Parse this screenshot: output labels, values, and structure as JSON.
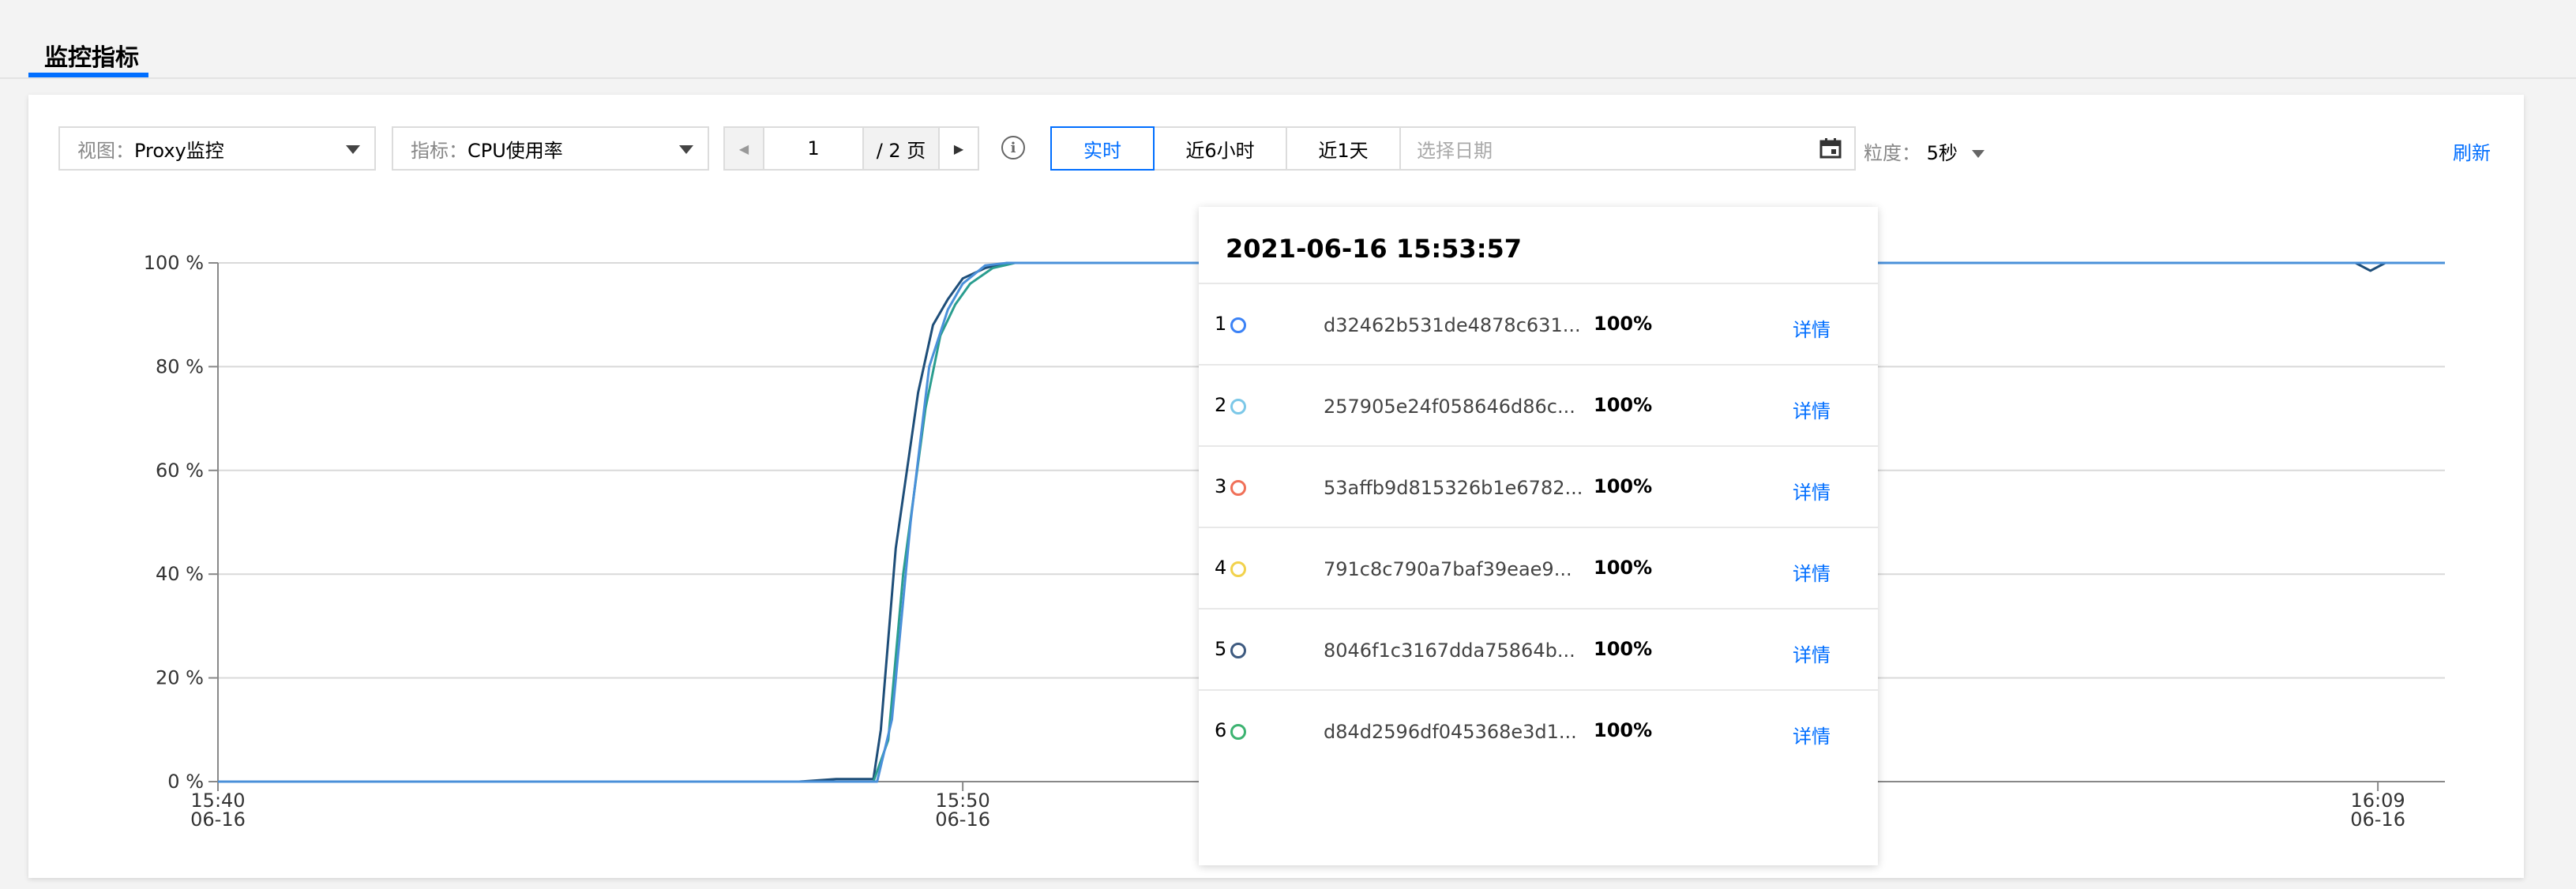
{
  "page": {
    "tab_title": "监控指标"
  },
  "toolbar": {
    "view_label": "视图：",
    "view_value": "Proxy监控",
    "metric_label": "指标：",
    "metric_value": "CPU使用率",
    "page_current": "1",
    "page_total": "/ 2 页",
    "range_buttons": [
      "实时",
      "近6小时",
      "近1天"
    ],
    "date_placeholder": "选择日期",
    "granularity_label": "粒度：",
    "granularity_value": "5秒",
    "refresh": "刷新"
  },
  "chart_data": {
    "type": "line",
    "y_ticks": [
      "100 %",
      "80 %",
      "60 %",
      "40 %",
      "20 %",
      "0 %"
    ],
    "ylim": [
      0,
      100
    ],
    "x_ticks": [
      {
        "time": "15:40",
        "date": "06-16"
      },
      {
        "time": "15:50",
        "date": "06-16"
      },
      {
        "time": "16:09",
        "date": "06-16"
      }
    ],
    "x_tick_minutes": [
      0,
      10,
      29
    ],
    "xlim_minutes": [
      0,
      29.9
    ],
    "grid": true,
    "series": [
      {
        "color": "#1e4e79",
        "points": [
          [
            0,
            0
          ],
          [
            7.8,
            0
          ],
          [
            8.3,
            0.5
          ],
          [
            8.8,
            0.5
          ],
          [
            8.9,
            10
          ],
          [
            9.1,
            45
          ],
          [
            9.4,
            75
          ],
          [
            9.6,
            88
          ],
          [
            9.8,
            93
          ],
          [
            10.0,
            97
          ],
          [
            10.3,
            99
          ],
          [
            10.6,
            100
          ],
          [
            14.5,
            100
          ],
          [
            14.7,
            99.5
          ],
          [
            14.9,
            100
          ],
          [
            28.7,
            100
          ],
          [
            28.9,
            98.5
          ],
          [
            29.1,
            100
          ],
          [
            29.9,
            100
          ]
        ]
      },
      {
        "color": "#2a9d8f",
        "points": [
          [
            0,
            0
          ],
          [
            8.8,
            0
          ],
          [
            9.0,
            8
          ],
          [
            9.2,
            40
          ],
          [
            9.5,
            72
          ],
          [
            9.7,
            86
          ],
          [
            9.9,
            92
          ],
          [
            10.1,
            96
          ],
          [
            10.4,
            99
          ],
          [
            10.7,
            100
          ],
          [
            29.9,
            100
          ]
        ]
      },
      {
        "color": "#4a90d9",
        "points": [
          [
            0,
            0
          ],
          [
            8.85,
            0
          ],
          [
            9.05,
            12
          ],
          [
            9.3,
            50
          ],
          [
            9.55,
            80
          ],
          [
            9.8,
            91
          ],
          [
            10.0,
            96
          ],
          [
            10.3,
            99.5
          ],
          [
            10.6,
            100
          ],
          [
            29.9,
            100
          ]
        ]
      }
    ],
    "cursor_minute": 14.0
  },
  "tooltip": {
    "time": "2021-06-16 15:53:57",
    "rows": [
      {
        "idx": "1",
        "color": "#3b82f6",
        "name": "d32462b531de4878c631...",
        "value": "100%",
        "action": "详情"
      },
      {
        "idx": "2",
        "color": "#7cc8e8",
        "name": "257905e24f058646d86c...",
        "value": "100%",
        "action": "详情"
      },
      {
        "idx": "3",
        "color": "#f07058",
        "name": "53affb9d815326b1e6782...",
        "value": "100%",
        "action": "详情"
      },
      {
        "idx": "4",
        "color": "#f2d24c",
        "name": "791c8c790a7baf39eae9...",
        "value": "100%",
        "action": "详情"
      },
      {
        "idx": "5",
        "color": "#3d5a80",
        "name": "8046f1c3167dda75864b...",
        "value": "100%",
        "action": "详情"
      },
      {
        "idx": "6",
        "color": "#3cb371",
        "name": "d84d2596df045368e3d1...",
        "value": "100%",
        "action": "详情"
      }
    ]
  }
}
